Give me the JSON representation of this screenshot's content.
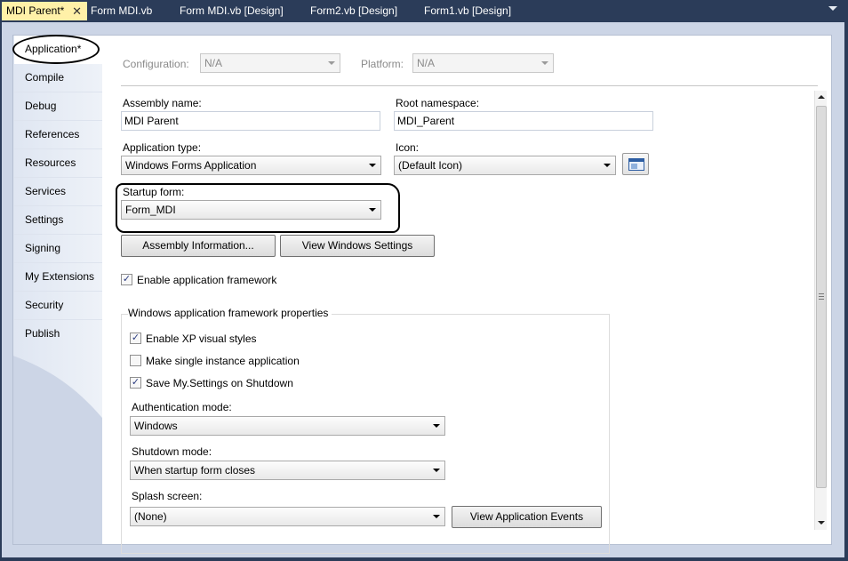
{
  "tabs": [
    {
      "label": "MDI Parent*",
      "active": true
    },
    {
      "label": "Form MDI.vb",
      "active": false
    },
    {
      "label": "Form MDI.vb [Design]",
      "active": false
    },
    {
      "label": "Form2.vb [Design]",
      "active": false
    },
    {
      "label": "Form1.vb [Design]",
      "active": false
    }
  ],
  "nav": {
    "items": [
      "Application*",
      "Compile",
      "Debug",
      "References",
      "Resources",
      "Services",
      "Settings",
      "Signing",
      "My Extensions",
      "Security",
      "Publish"
    ],
    "selected": "Application*"
  },
  "config": {
    "configuration_label": "Configuration:",
    "configuration_value": "N/A",
    "platform_label": "Platform:",
    "platform_value": "N/A"
  },
  "app": {
    "assembly_name_label": "Assembly name:",
    "assembly_name": "MDI Parent",
    "root_namespace_label": "Root namespace:",
    "root_namespace": "MDI_Parent",
    "application_type_label": "Application type:",
    "application_type": "Windows Forms Application",
    "icon_label": "Icon:",
    "icon_value": "(Default Icon)",
    "startup_form_label": "Startup form:",
    "startup_form": "Form_MDI",
    "assembly_info_button": "Assembly Information...",
    "view_windows_settings_button": "View Windows Settings",
    "enable_framework_label": "Enable application framework",
    "enable_framework_checked": true
  },
  "framework": {
    "group_title": "Windows application framework properties",
    "xp_styles_label": "Enable XP visual styles",
    "xp_styles_checked": true,
    "single_instance_label": "Make single instance application",
    "single_instance_checked": false,
    "save_settings_label": "Save My.Settings on Shutdown",
    "save_settings_checked": true,
    "auth_mode_label": "Authentication mode:",
    "auth_mode": "Windows",
    "shutdown_mode_label": "Shutdown mode:",
    "shutdown_mode": "When startup form closes",
    "splash_label": "Splash screen:",
    "splash_value": "(None)",
    "view_events_button": "View Application Events"
  },
  "icons": {
    "tab_close": "close-icon",
    "icon_preview": "window-icon"
  }
}
